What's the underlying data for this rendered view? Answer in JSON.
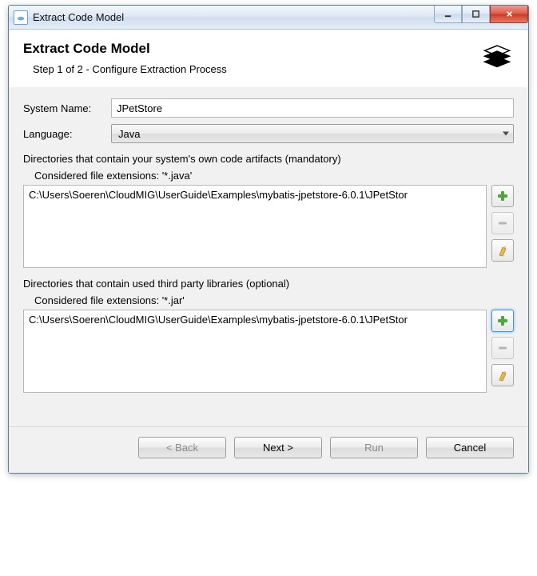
{
  "titlebar": {
    "title": "Extract Code Model"
  },
  "header": {
    "title": "Extract Code Model",
    "subtitle": "Step 1 of 2 - Configure Extraction Process"
  },
  "form": {
    "system_name_label": "System Name:",
    "system_name_value": "JPetStore",
    "language_label": "Language:",
    "language_value": "Java"
  },
  "own_code": {
    "label": "Directories that contain your system's own code artifacts (mandatory)",
    "ext_label": "Considered file extensions:  '*.java'",
    "items": [
      "C:\\Users\\Soeren\\CloudMIG\\UserGuide\\Examples\\mybatis-jpetstore-6.0.1\\JPetStor"
    ]
  },
  "third_party": {
    "label": "Directories that contain used third party libraries (optional)",
    "ext_label": "Considered file extensions:  '*.jar'",
    "items": [
      "C:\\Users\\Soeren\\CloudMIG\\UserGuide\\Examples\\mybatis-jpetstore-6.0.1\\JPetStor"
    ]
  },
  "footer": {
    "back": "< Back",
    "next": "Next >",
    "run": "Run",
    "cancel": "Cancel"
  }
}
